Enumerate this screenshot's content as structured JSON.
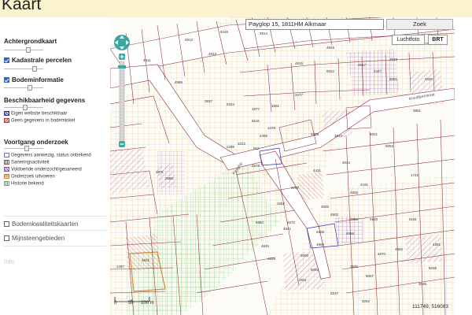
{
  "header": {
    "title": "Kaart"
  },
  "sidebar": {
    "basemap_label": "Achtergrondkaart",
    "cadastral_label": "Kadastrale percelen",
    "soil_label": "Bodeminformatie",
    "availability_heading": "Beschikbaarheid gegevens",
    "availability_items": [
      {
        "label": "Eigen website beschikbaar",
        "color": "#2b2bb0"
      },
      {
        "label": "Geen gegevens in bodemloket",
        "color": "#c0392b"
      }
    ],
    "progress_heading": "Voortgang onderzoek",
    "progress_items": [
      {
        "label": "Gegevens aanwezig, status onbekend",
        "color": "#6a6fb8"
      },
      {
        "label": "Saneringsactiviteit",
        "color": "#a24a4a"
      },
      {
        "label": "Voldoende onderzocht/gesaneerd",
        "color": "#8a56b0"
      },
      {
        "label": "Onderzoek uitvoeren",
        "color": "#d08a40"
      },
      {
        "label": "Historie bekend",
        "color": "#5fae5f"
      }
    ],
    "soilquality_label": "Bodemkwaliteitskaarten",
    "mining_label": "Mijnsteengebieden",
    "footer_text": "Info"
  },
  "search": {
    "value": "Payglop 15, 1811HM Alkmaar",
    "button": "Zoek"
  },
  "map_toggles": {
    "aerial": "Luchtfoto",
    "brt": "BRT"
  },
  "scale": {
    "label_0": "0",
    "label_1": "50",
    "label_2": "100 m"
  },
  "coords": {
    "text": "111749, 516083"
  },
  "map_labels": {
    "parcels": [
      "4811",
      "4812",
      "4813",
      "4814",
      "4815",
      "4816",
      "4817",
      "4818",
      "4819",
      "4820",
      "3837",
      "5224",
      "1877",
      "1601",
      "2477",
      "6116",
      "1478",
      "2495",
      "3312",
      "612",
      "2578",
      "4431",
      "5022",
      "8061",
      "4809",
      "4810",
      "5031",
      "3851",
      "2447",
      "5052",
      "3767",
      "4042",
      "4161",
      "1742",
      "4845",
      "4866",
      "4848",
      "5272",
      "3262",
      "5584",
      "4846",
      "4328",
      "5000",
      "2811",
      "4868",
      "4870",
      "5181",
      "4862",
      "3645",
      "5007",
      "3262",
      "2247",
      "5036",
      "3045",
      "4351",
      "2288",
      "2680",
      "3871",
      "1497",
      "4931",
      "4986",
      "5245",
      "4841",
      "5306",
      "5046",
      "4858",
      "4902",
      "4825"
    ],
    "street_a": "Payglop",
    "street_b": "Koedijkerstraat"
  }
}
